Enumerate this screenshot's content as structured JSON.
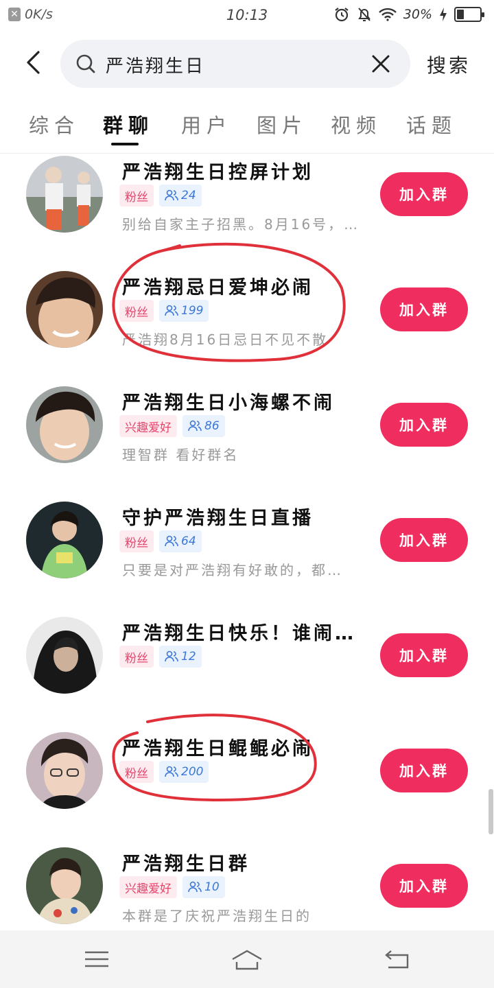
{
  "status_bar": {
    "net_speed": "0K/s",
    "time": "10:13",
    "battery": "30%",
    "battery_level": 0.3
  },
  "search": {
    "query": "严浩翔生日",
    "submit_label": "搜索"
  },
  "tabs": [
    {
      "label": "综合",
      "active": false
    },
    {
      "label": "群聊",
      "active": true
    },
    {
      "label": "用户",
      "active": false
    },
    {
      "label": "图片",
      "active": false
    },
    {
      "label": "视频",
      "active": false
    },
    {
      "label": "话题",
      "active": false
    }
  ],
  "join_label": "加入群",
  "groups": [
    {
      "title": "严浩翔生日控屏计划",
      "category": "粉丝",
      "members": "24",
      "description": "别给自家主子招黑。8月16号，…"
    },
    {
      "title": "严浩翔忌日爱坤必闹",
      "category": "粉丝",
      "members": "199",
      "description": "严浩翔8月16日忌日不见不散"
    },
    {
      "title": "严浩翔生日小海螺不闹",
      "category": "兴趣爱好",
      "members": "86",
      "description": "理智群 看好群名"
    },
    {
      "title": "守护严浩翔生日直播",
      "category": "粉丝",
      "members": "64",
      "description": "只要是对严浩翔有好敢的，都…"
    },
    {
      "title": "严浩翔生日快乐！谁闹…",
      "category": "粉丝",
      "members": "12",
      "description": ""
    },
    {
      "title": "严浩翔生日鲲鲲必闹",
      "category": "粉丝",
      "members": "200",
      "description": ""
    },
    {
      "title": "严浩翔生日群",
      "category": "兴趣爱好",
      "members": "10",
      "description": "本群是了庆祝严浩翔生日的"
    }
  ],
  "colors": {
    "accent": "#ef2d5e",
    "tag_pink": "#e6436a",
    "tag_blue": "#3b78d8",
    "annotation": "#e0303a"
  }
}
